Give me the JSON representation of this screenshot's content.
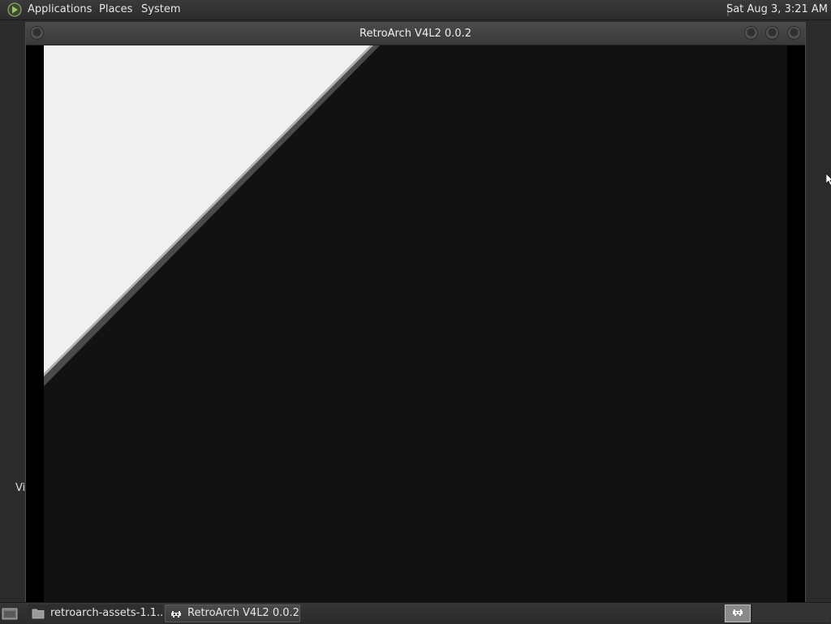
{
  "top_panel": {
    "menus": [
      "Applications",
      "Places",
      "System"
    ],
    "clock": "Sat Aug  3,  3:21 AM",
    "logo_icon": "distro-logo-icon"
  },
  "desktop": {
    "partial_icon_label": "Vi"
  },
  "window": {
    "title": "RetroArch V4L2 0.0.2",
    "buttons": [
      "window-menu-icon",
      "minimize-icon",
      "maximize-icon",
      "close-icon"
    ],
    "video_colors": {
      "light": "#f0f0f0",
      "dark": "#121212"
    }
  },
  "taskbar": {
    "tasks": [
      {
        "label": "retroarch-assets-1.1...",
        "icon": "folder-icon",
        "active": false
      },
      {
        "label": "RetroArch V4L2 0.0.2",
        "icon": "retroarch-invader-icon",
        "active": true
      }
    ],
    "workspace_icon": "retroarch-invader-icon"
  }
}
